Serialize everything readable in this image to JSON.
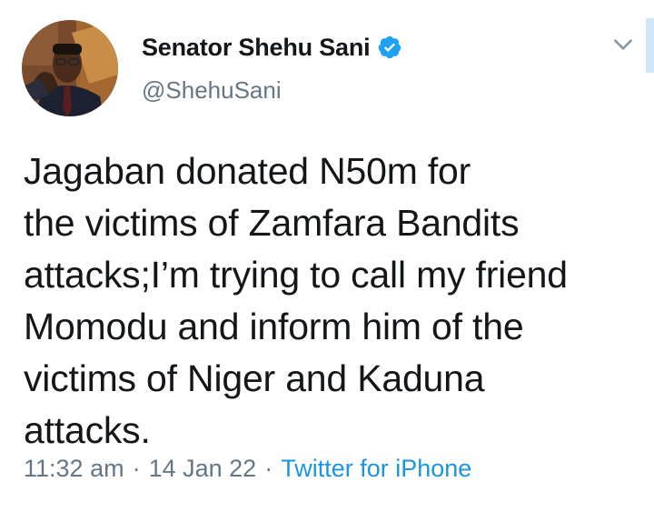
{
  "author": {
    "display_name": "Senator Shehu Sani",
    "handle": "@ShehuSani",
    "verified": true
  },
  "tweet": {
    "text": "Jagaban donated N50m for\nthe victims of Zamfara Bandits\nattacks;I’m trying to call my friend\nMomodu and inform him of the\nvictims of Niger and Kaduna\nattacks."
  },
  "meta": {
    "time": "11:32 am",
    "separator": "·",
    "date": "14 Jan 22",
    "source": "Twitter for iPhone"
  },
  "icons": {
    "verified": "verified-badge-icon",
    "caret": "chevron-down-icon"
  },
  "colors": {
    "verified_blue": "#1da1f2",
    "link_blue": "#1b95e0",
    "secondary_text": "#657786"
  }
}
